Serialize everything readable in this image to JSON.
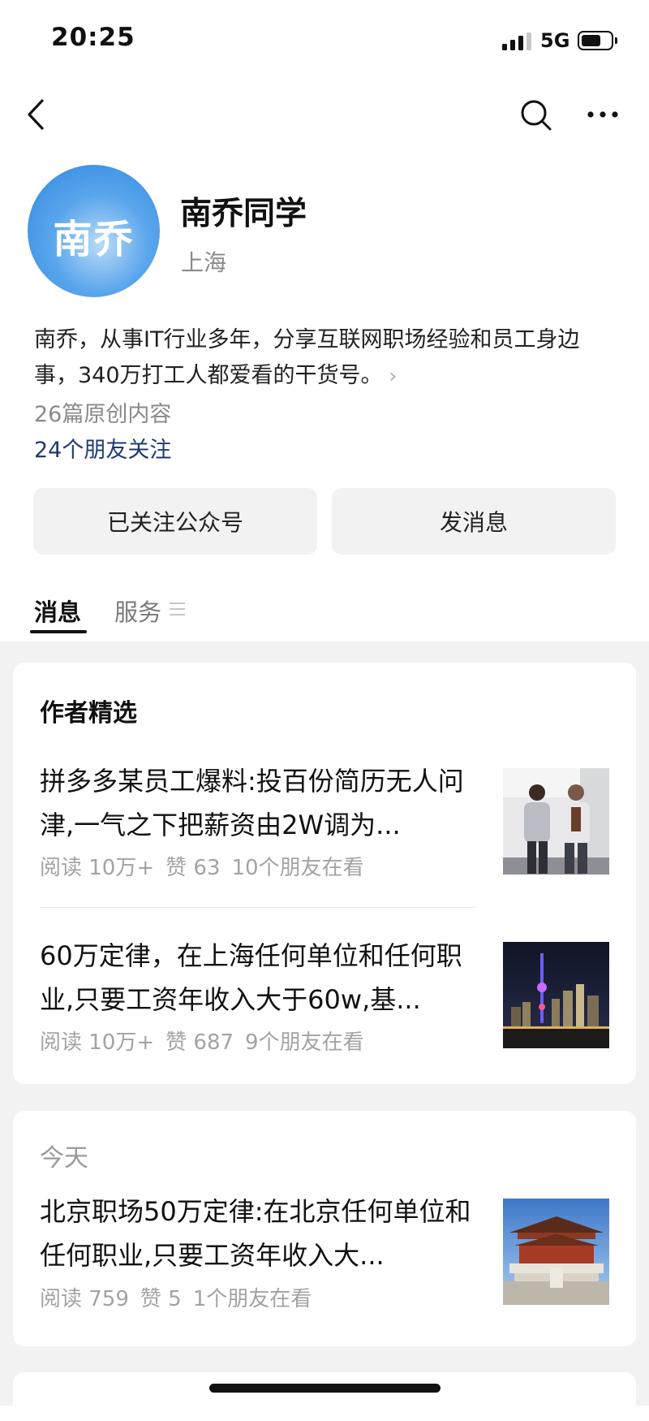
{
  "status_bar": {
    "time": "20:25",
    "network": "5G",
    "signal_bars_active": 3,
    "battery_icon": "battery-icon"
  },
  "nav": {
    "back_icon": "chevron-left-icon",
    "search_icon": "search-icon",
    "more_icon": "more-icon"
  },
  "profile": {
    "avatar_text": "南乔",
    "name": "南乔同学",
    "location": "上海",
    "intro": "南乔，从事IT行业多年，分享互联网职场经验和员工身边事，340万打工人都爱看的干货号。",
    "intro_arrow": "›",
    "original_count": "26篇原创内容",
    "friends_follow": "24个朋友关注"
  },
  "buttons": {
    "followed": "已关注公众号",
    "message": "发消息"
  },
  "tabs": {
    "messages": "消息",
    "services": "服务"
  },
  "featured": {
    "title": "作者精选",
    "articles": [
      {
        "title": "拼多多某员工爆料:投百份简历无人问津,一气之下把薪资由2W调为...",
        "reads": "阅读 10万+",
        "likes": "赞 63",
        "friends": "10个朋友在看"
      },
      {
        "title": "60万定律，在上海任何单位和任何职业,只要工资年收入大于60w,基...",
        "reads": "阅读 10万+",
        "likes": "赞 687",
        "friends": "9个朋友在看"
      }
    ]
  },
  "today": {
    "date": "今天",
    "articles": [
      {
        "title": "北京职场50万定律:在北京任何单位和任何职业,只要工资年收入大...",
        "reads": "阅读 759",
        "likes": "赞 5",
        "friends": "1个朋友在看"
      }
    ]
  },
  "colors": {
    "link": "#1f3a73",
    "avatar_blue": "#2e86e0",
    "secondary_text": "#a3a3a3",
    "background": "#f2f2f2"
  }
}
